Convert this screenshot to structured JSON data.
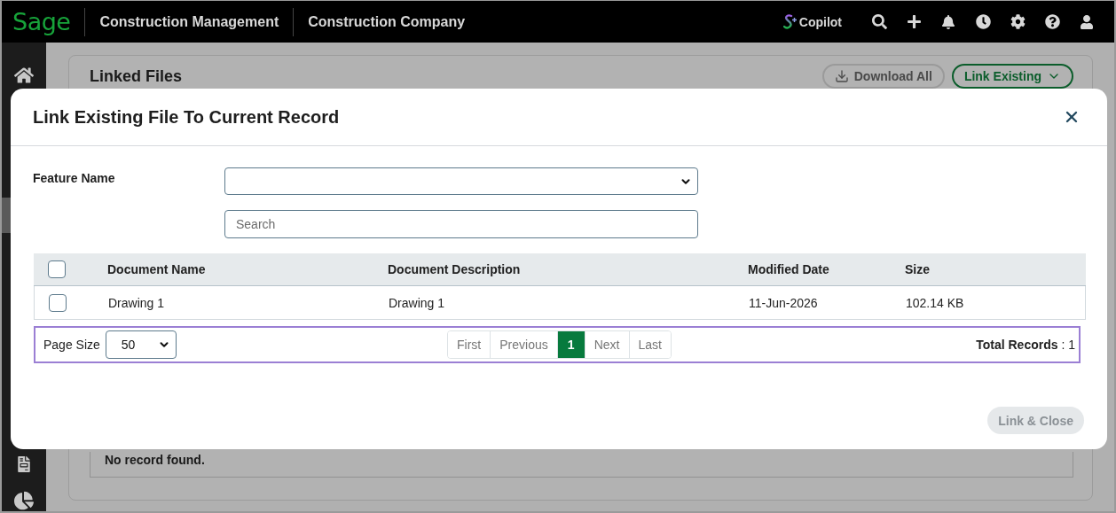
{
  "header": {
    "logo": "Sage",
    "app": "Construction Management",
    "company": "Construction Company",
    "copilot": "Copilot"
  },
  "sidebar": {
    "items": [
      {
        "kind": "home",
        "selected": false
      },
      {
        "kind": "blank",
        "selected": true
      },
      {
        "kind": "sheet",
        "selected": false
      },
      {
        "kind": "chart",
        "selected": false
      }
    ]
  },
  "card": {
    "title": "Linked Files",
    "download_button": "Download All",
    "link_button": "Link Existing",
    "empty_text": "No record found."
  },
  "modal": {
    "title": "Link Existing File To Current Record",
    "feature_label": "Feature Name",
    "search": {
      "placeholder": "Search"
    },
    "table": {
      "header_checked": false,
      "columns": [
        "Document Name",
        "Document Description",
        "Modified Date",
        "Size"
      ],
      "rows": [
        {
          "checked": false,
          "cells": [
            "Drawing 1",
            "Drawing 1",
            "11-Jun-2026",
            "102.14 KB"
          ]
        }
      ]
    },
    "pager": {
      "page_size_label": "Page Size",
      "page_size": "50",
      "pages": [
        {
          "label": "First",
          "selected": false
        },
        {
          "label": "Previous",
          "selected": false
        },
        {
          "label": "1",
          "selected": true
        },
        {
          "label": "Next",
          "selected": false
        },
        {
          "label": "Last",
          "selected": false
        }
      ],
      "total": "**Total Records** : 1"
    },
    "footer_button": {
      "label": "Link & Close",
      "disabled": true
    }
  }
}
